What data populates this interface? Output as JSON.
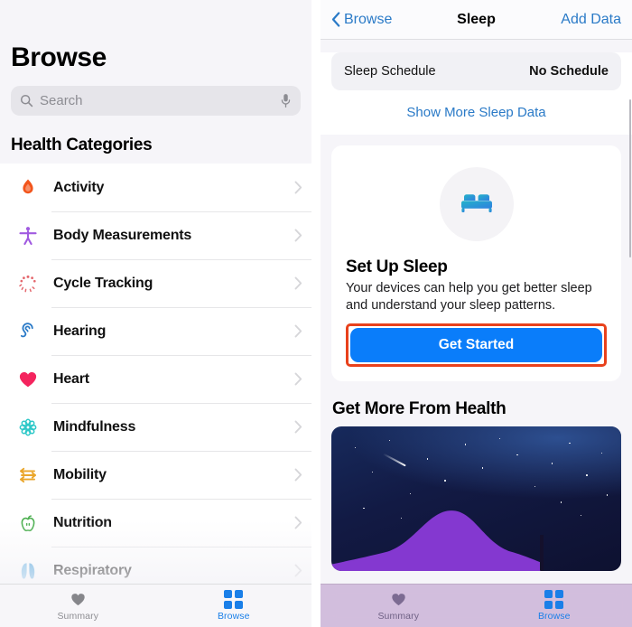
{
  "left_screen": {
    "title": "Browse",
    "search": {
      "placeholder": "Search",
      "value": "",
      "search_icon": "search-icon",
      "mic_icon": "microphone-icon"
    },
    "section_header": "Health Categories",
    "categories": [
      {
        "label": "Activity",
        "icon": "flame-icon",
        "color": "#f2541b"
      },
      {
        "label": "Body Measurements",
        "icon": "body-figure-icon",
        "color": "#a05ae0"
      },
      {
        "label": "Cycle Tracking",
        "icon": "cycle-dots-icon",
        "color": "#e4686e"
      },
      {
        "label": "Hearing",
        "icon": "ear-icon",
        "color": "#2a7ac7"
      },
      {
        "label": "Heart",
        "icon": "heart-icon",
        "color": "#f4245e"
      },
      {
        "label": "Mindfulness",
        "icon": "mandala-icon",
        "color": "#2ec8c8"
      },
      {
        "label": "Mobility",
        "icon": "arrows-icon",
        "color": "#eaa62b"
      },
      {
        "label": "Nutrition",
        "icon": "apple-icon",
        "color": "#4caf50"
      },
      {
        "label": "Respiratory",
        "icon": "lungs-icon",
        "color": "#4aa3dd"
      }
    ],
    "tabbar": {
      "tabs": [
        {
          "label": "Summary",
          "icon": "heart-icon",
          "active": false
        },
        {
          "label": "Browse",
          "icon": "grid-icon",
          "active": true
        }
      ]
    }
  },
  "right_screen": {
    "navbar": {
      "back_label": "Browse",
      "back_icon": "chevron-left-icon",
      "title": "Sleep",
      "action_label": "Add Data"
    },
    "sleep_schedule": {
      "label": "Sleep Schedule",
      "value": "No Schedule"
    },
    "show_more_link": "Show More Sleep Data",
    "setup_card": {
      "icon": "bed-icon",
      "title": "Set Up Sleep",
      "description": "Your devices can help you get better sleep and understand your sleep patterns.",
      "cta_label": "Get Started",
      "cta_color": "#0a7dfa",
      "highlight_color": "#e8411c"
    },
    "get_more": {
      "title": "Get More From Health",
      "image_alt": "night-sky-hill-illustration"
    },
    "tabbar": {
      "tabs": [
        {
          "label": "Summary",
          "icon": "heart-icon",
          "active": false
        },
        {
          "label": "Browse",
          "icon": "grid-icon",
          "active": true
        }
      ]
    }
  }
}
